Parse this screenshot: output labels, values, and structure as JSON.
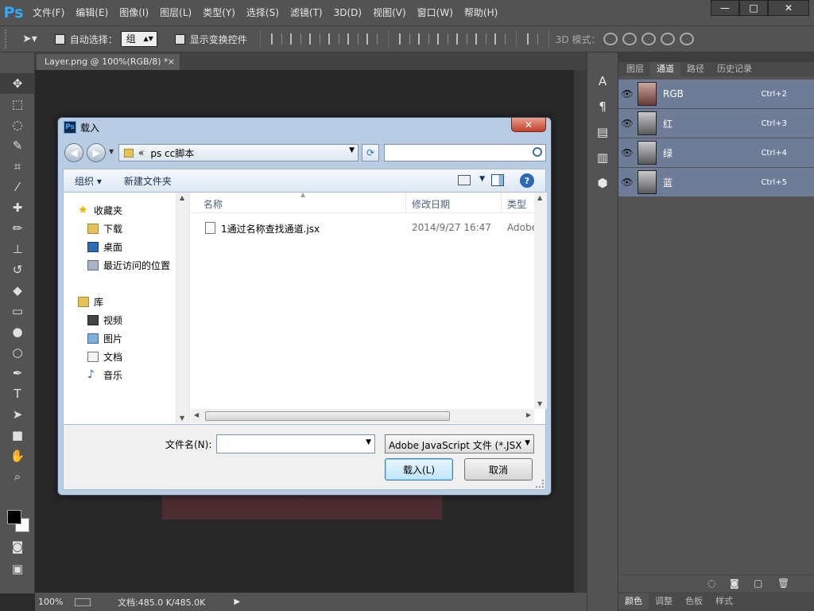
{
  "app": {
    "logo": "Ps",
    "menu": [
      "文件(F)",
      "编辑(E)",
      "图像(I)",
      "图层(L)",
      "类型(Y)",
      "选择(S)",
      "滤镜(T)",
      "3D(D)",
      "视图(V)",
      "窗口(W)",
      "帮助(H)"
    ],
    "window_controls": {
      "minimize": "—",
      "maximize": "□",
      "close": "✕"
    }
  },
  "options_bar": {
    "auto_select_label": "自动选择：",
    "auto_select_value": "组",
    "show_transform_label": "显示变换控件",
    "mode_3d_label": "3D 模式："
  },
  "document": {
    "tab_title": "Layer.png @ 100%(RGB/8) *",
    "tab_close": "×",
    "zoom": "100%",
    "doc_info": "文档:485.0 K/485.0K"
  },
  "panel": {
    "tabs": [
      "图层",
      "通道",
      "路径",
      "历史记录"
    ],
    "active_tab": "通道",
    "channels": [
      {
        "name": "RGB",
        "shortcut": "Ctrl+2"
      },
      {
        "name": "红",
        "shortcut": "Ctrl+3"
      },
      {
        "name": "绿",
        "shortcut": "Ctrl+4"
      },
      {
        "name": "蓝",
        "shortcut": "Ctrl+5"
      }
    ],
    "bottom_tabs": [
      "颜色",
      "调整",
      "色板",
      "样式"
    ]
  },
  "dialog": {
    "title": "载入",
    "address": {
      "prefix": "«",
      "path": "ps cc脚本"
    },
    "search_placeholder": "",
    "commands": {
      "organize": "组织 ▾",
      "new_folder": "新建文件夹"
    },
    "nav": {
      "favorites": "收藏夹",
      "downloads": "下载",
      "desktop": "桌面",
      "recent": "最近访问的位置",
      "libraries": "库",
      "videos": "视频",
      "pictures": "图片",
      "documents": "文档",
      "music": "音乐"
    },
    "columns": {
      "name": "名称",
      "modified": "修改日期",
      "type": "类型"
    },
    "files": [
      {
        "name": "1通过名称查找通道.jsx",
        "modified": "2014/9/27 16:47",
        "type": "Adobe"
      }
    ],
    "filename_label": "文件名(N):",
    "filename_value": "",
    "filetype": "Adobe JavaScript 文件 (*.JSX",
    "load_button": "载入(L)",
    "cancel_button": "取消"
  }
}
